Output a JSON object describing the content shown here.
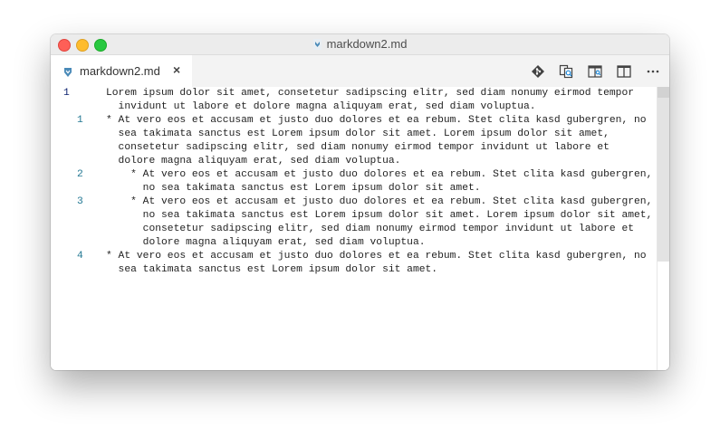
{
  "window": {
    "title": "markdown2.md"
  },
  "tab": {
    "label": "markdown2.md",
    "close_glyph": "×"
  },
  "toolbar": {
    "icons": [
      "git-compare-icon",
      "open-changes-icon",
      "open-preview-icon",
      "split-editor-icon",
      "more-actions-icon"
    ],
    "more_glyph": "···"
  },
  "editor": {
    "line_number_color": "#237893",
    "active_line_number_color": "#0b216f",
    "lines": [
      {
        "num": "1",
        "row": 0,
        "num_col": "main",
        "text": "Lorem ipsum dolor sit amet, consetetur sadipscing elitr, sed diam nonumy eirmod tempor"
      },
      {
        "num": "",
        "row": 1,
        "text": "  invidunt ut labore et dolore magna aliquyam erat, sed diam voluptua."
      },
      {
        "num": "1",
        "row": 2,
        "num_col": "list",
        "text": "* At vero eos et accusam et justo duo dolores et ea rebum. Stet clita kasd gubergren, no"
      },
      {
        "num": "",
        "row": 3,
        "text": "  sea takimata sanctus est Lorem ipsum dolor sit amet. Lorem ipsum dolor sit amet,"
      },
      {
        "num": "",
        "row": 4,
        "text": "  consetetur sadipscing elitr, sed diam nonumy eirmod tempor invidunt ut labore et"
      },
      {
        "num": "",
        "row": 5,
        "text": "  dolore magna aliquyam erat, sed diam voluptua."
      },
      {
        "num": "2",
        "row": 6,
        "num_col": "list",
        "text": "    * At vero eos et accusam et justo duo dolores et ea rebum. Stet clita kasd gubergren,"
      },
      {
        "num": "",
        "row": 7,
        "text": "      no sea takimata sanctus est Lorem ipsum dolor sit amet."
      },
      {
        "num": "3",
        "row": 8,
        "num_col": "list",
        "text": "    * At vero eos et accusam et justo duo dolores et ea rebum. Stet clita kasd gubergren,"
      },
      {
        "num": "",
        "row": 9,
        "text": "      no sea takimata sanctus est Lorem ipsum dolor sit amet. Lorem ipsum dolor sit amet,"
      },
      {
        "num": "",
        "row": 10,
        "text": "      consetetur sadipscing elitr, sed diam nonumy eirmod tempor invidunt ut labore et"
      },
      {
        "num": "",
        "row": 11,
        "text": "      dolore magna aliquyam erat, sed diam voluptua."
      },
      {
        "num": "4",
        "row": 12,
        "num_col": "list",
        "text": "* At vero eos et accusam et justo duo dolores et ea rebum. Stet clita kasd gubergren, no"
      },
      {
        "num": "",
        "row": 13,
        "text": "  sea takimata sanctus est Lorem ipsum dolor sit amet."
      }
    ]
  }
}
